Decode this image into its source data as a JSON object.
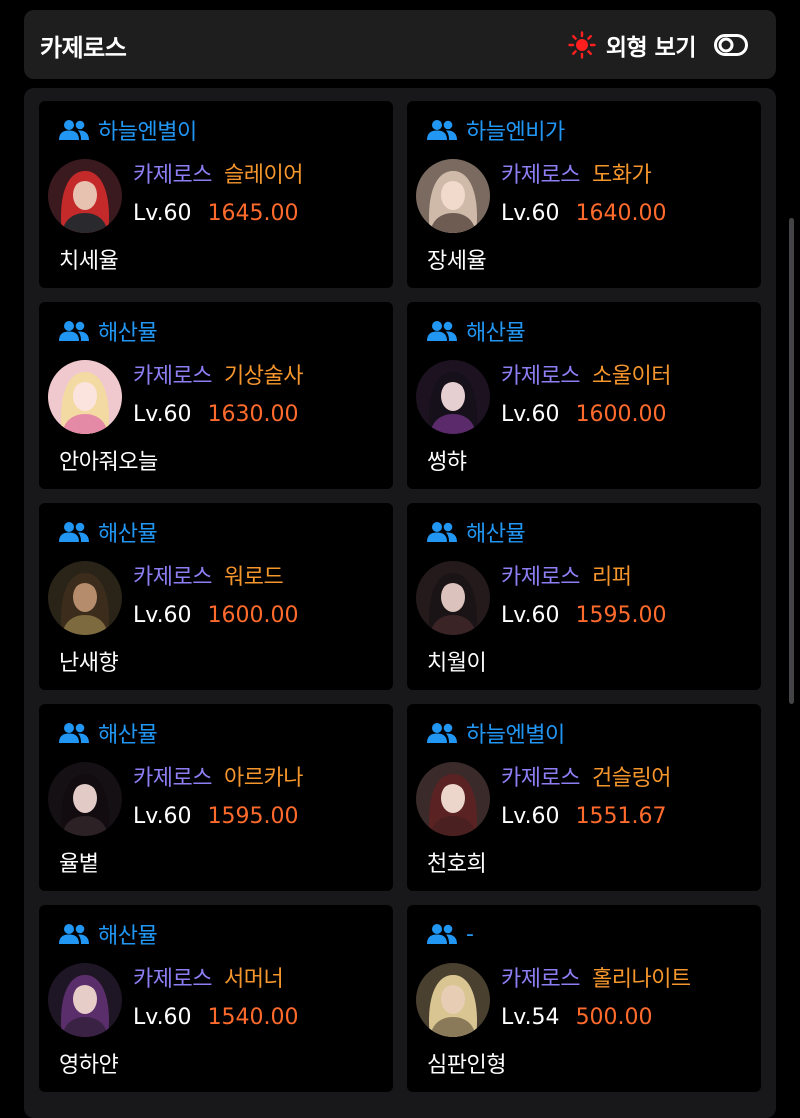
{
  "header": {
    "title": "카제로스",
    "appearance_label": "외형 보기",
    "sun_icon": "sun-icon",
    "toggle_icon": "toggle-icon",
    "accent_color": "#ff1f1f"
  },
  "colors": {
    "guild": "#2196f3",
    "server": "#8c7ef3",
    "class": "#f5962c",
    "item_level": "#ff6b2c"
  },
  "cards": [
    {
      "guild": "하늘엔별이",
      "server": "카제로스",
      "class": "슬레이어",
      "level": "Lv.60",
      "item_level": "1645.00",
      "name": "치세율",
      "avatar": {
        "bg": "#3a1a1e",
        "hair": "#c42a2a",
        "skin": "#e8c2b0",
        "cloth": "#2a2a2e"
      }
    },
    {
      "guild": "하늘엔비가",
      "server": "카제로스",
      "class": "도화가",
      "level": "Lv.60",
      "item_level": "1640.00",
      "name": "장세율",
      "avatar": {
        "bg": "#7a6a60",
        "hair": "#cfb9a8",
        "skin": "#f1d9cc",
        "cloth": "#6e5b52"
      }
    },
    {
      "guild": "해산뮬",
      "server": "카제로스",
      "class": "기상술사",
      "level": "Lv.60",
      "item_level": "1630.00",
      "name": "안아줘오늘",
      "avatar": {
        "bg": "#f0c9cf",
        "hair": "#f3d9a2",
        "skin": "#fbe4dd",
        "cloth": "#e58aa6"
      }
    },
    {
      "guild": "해산뮬",
      "server": "카제로스",
      "class": "소울이터",
      "level": "Lv.60",
      "item_level": "1600.00",
      "name": "썽햐",
      "avatar": {
        "bg": "#1c1220",
        "hair": "#15101a",
        "skin": "#e6cfd0",
        "cloth": "#5b2a6a"
      }
    },
    {
      "guild": "해산뮬",
      "server": "카제로스",
      "class": "워로드",
      "level": "Lv.60",
      "item_level": "1600.00",
      "name": "난새향",
      "avatar": {
        "bg": "#2a2418",
        "hair": "#3b2c1c",
        "skin": "#b58d6d",
        "cloth": "#7d6a3e"
      }
    },
    {
      "guild": "해산뮬",
      "server": "카제로스",
      "class": "리퍼",
      "level": "Lv.60",
      "item_level": "1595.00",
      "name": "치월이",
      "avatar": {
        "bg": "#241a1c",
        "hair": "#1b1416",
        "skin": "#dcc2bd",
        "cloth": "#3a2426"
      }
    },
    {
      "guild": "해산뮬",
      "server": "카제로스",
      "class": "아르카나",
      "level": "Lv.60",
      "item_level": "1595.00",
      "name": "율볕",
      "avatar": {
        "bg": "#141014",
        "hair": "#120c10",
        "skin": "#e2cbc6",
        "cloth": "#2c2226"
      }
    },
    {
      "guild": "하늘엔별이",
      "server": "카제로스",
      "class": "건슬링어",
      "level": "Lv.60",
      "item_level": "1551.67",
      "name": "천호희",
      "avatar": {
        "bg": "#3a2a2a",
        "hair": "#5a2222",
        "skin": "#ecd6cc",
        "cloth": "#4a2020"
      }
    },
    {
      "guild": "해산뮬",
      "server": "카제로스",
      "class": "서머너",
      "level": "Lv.60",
      "item_level": "1540.00",
      "name": "영하얀",
      "avatar": {
        "bg": "#1e1624",
        "hair": "#5a2e6a",
        "skin": "#e6cdc8",
        "cloth": "#3a2244"
      }
    },
    {
      "guild": "-",
      "server": "카제로스",
      "class": "홀리나이트",
      "level": "Lv.54",
      "item_level": "500.00",
      "name": "심판인형",
      "avatar": {
        "bg": "#4a4030",
        "hair": "#d9c592",
        "skin": "#e6cdb4",
        "cloth": "#8a7a5a"
      }
    }
  ]
}
